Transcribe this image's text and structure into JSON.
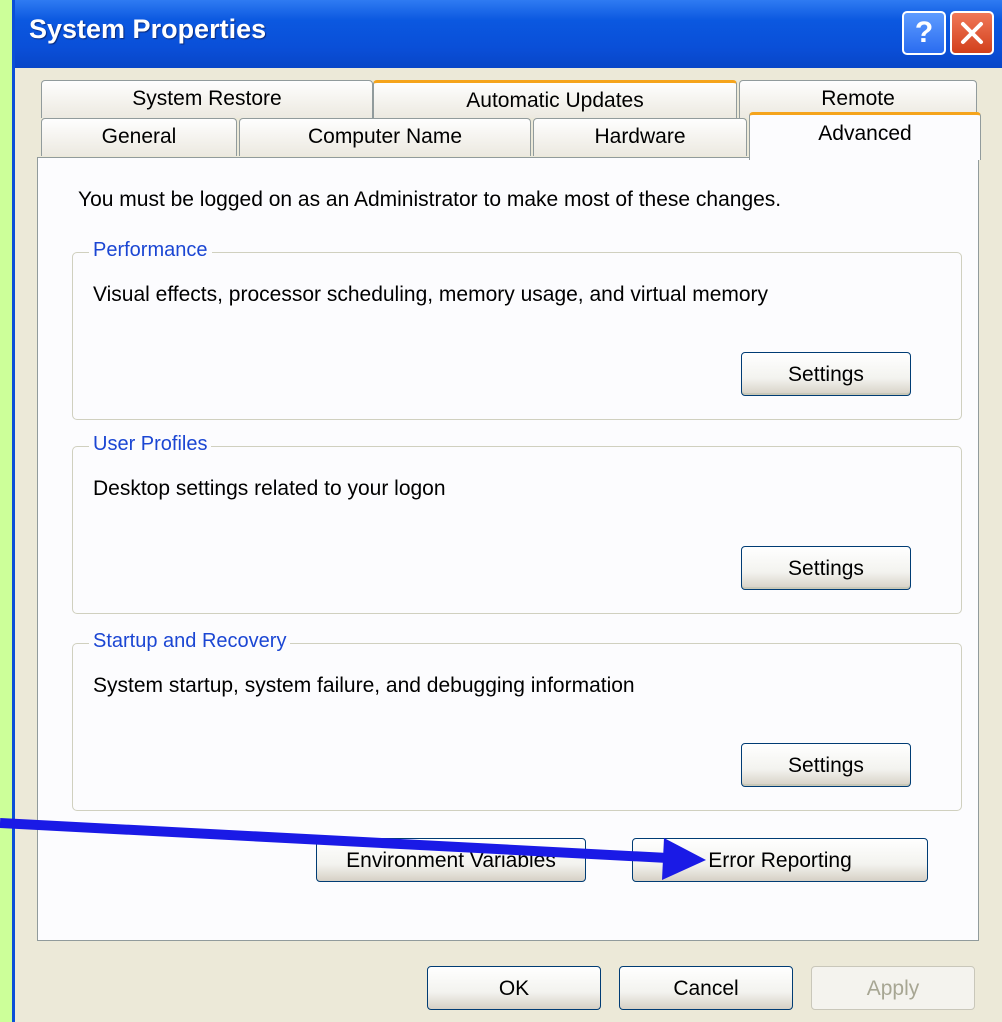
{
  "window": {
    "title": "System Properties",
    "help_icon": "?",
    "close_icon": "close-x"
  },
  "tabs": {
    "row1": [
      "System Restore",
      "Automatic Updates",
      "Remote"
    ],
    "row2": [
      "General",
      "Computer Name",
      "Hardware",
      "Advanced"
    ],
    "active": "Advanced"
  },
  "advanced": {
    "intro": "You must be logged on as an Administrator to make most of these changes.",
    "performance": {
      "title": "Performance",
      "description": "Visual effects, processor scheduling, memory usage, and virtual memory",
      "button": "Settings"
    },
    "user_profiles": {
      "title": "User Profiles",
      "description": "Desktop settings related to your logon",
      "button": "Settings"
    },
    "startup_recovery": {
      "title": "Startup and Recovery",
      "description": "System startup, system failure, and debugging information",
      "button": "Settings"
    },
    "env_vars_button": "Environment Variables",
    "error_reporting_button": "Error Reporting"
  },
  "footer": {
    "ok": "OK",
    "cancel": "Cancel",
    "apply": "Apply"
  },
  "colors": {
    "background": "#ccff99",
    "titlebar": "#0a4fd8",
    "group_title": "#1b46d3",
    "tab_highlight": "#f5a41c",
    "annotation_arrow": "#1a1ae6"
  }
}
